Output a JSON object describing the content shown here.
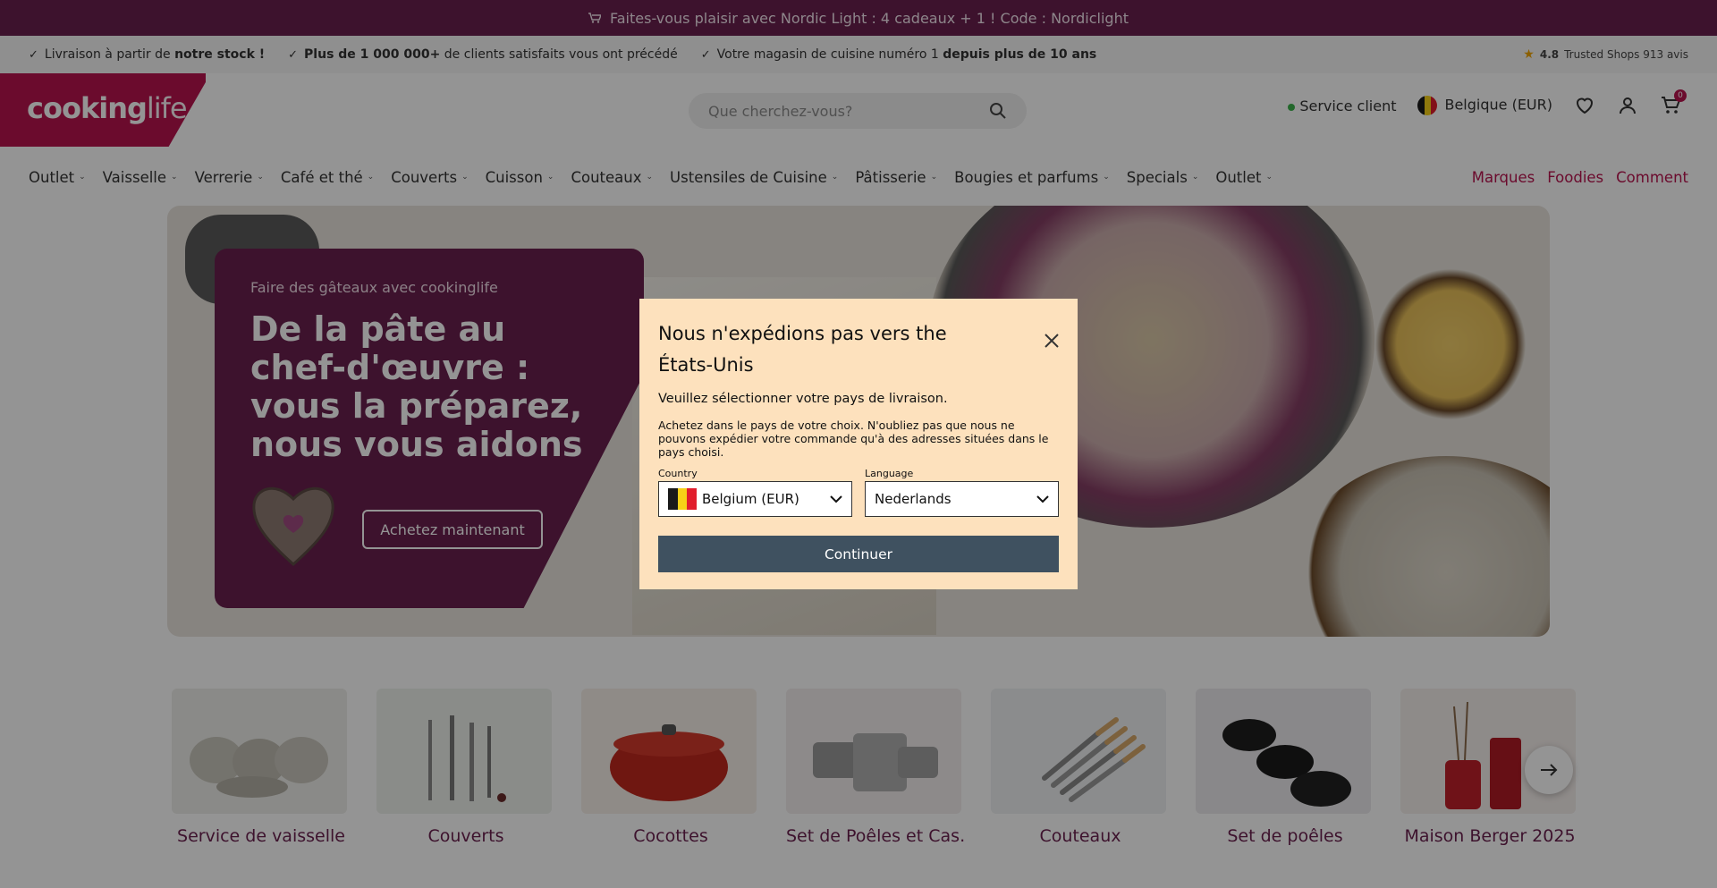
{
  "announcement": {
    "text": "Faites-vous plaisir avec Nordic Light : 4 cadeaux + 1 ! Code : Nordiclight"
  },
  "usp": [
    {
      "pre": "Livraison à partir de ",
      "bold": "notre stock !",
      "post": ""
    },
    {
      "pre": "",
      "bold": "Plus de 1 000 000+",
      "post": " de clients satisfaits vous ont précédé"
    },
    {
      "pre": "Votre magasin de cuisine numéro 1 ",
      "bold": "depuis plus de 10 ans",
      "post": ""
    }
  ],
  "rating": {
    "score": "4.8",
    "text": "Trusted Shops 913 avis"
  },
  "logo": {
    "part1": "cooking",
    "part2": "life"
  },
  "search": {
    "placeholder": "Que cherchez-vous?"
  },
  "header": {
    "service": "Service client",
    "country": "Belgique (EUR)",
    "cart_count": "0"
  },
  "nav": {
    "items": [
      "Outlet",
      "Vaisselle",
      "Verrerie",
      "Café et thé",
      "Couverts",
      "Cuisson",
      "Couteaux",
      "Ustensiles de Cuisine",
      "Pâtisserie",
      "Bougies et parfums",
      "Specials",
      "Outlet"
    ],
    "right": [
      "Marques",
      "Foodies",
      "Comment"
    ]
  },
  "hero": {
    "eyebrow": "Faire des gâteaux avec cookinglife",
    "title": "De la pâte au chef-d'œuvre : vous la préparez, nous vous aidons",
    "cta": "Achetez maintenant"
  },
  "categories": [
    {
      "label": "Service de vaisselle",
      "bg": "#eeeeea"
    },
    {
      "label": "Couverts",
      "bg": "#eef2ec"
    },
    {
      "label": "Cocottes",
      "bg": "#f7efe9"
    },
    {
      "label": "Set de Poêles et Cas…",
      "bg": "#f3eeee"
    },
    {
      "label": "Couteaux",
      "bg": "#f0f1f3"
    },
    {
      "label": "Set de poêles",
      "bg": "#ecebee"
    },
    {
      "label": "Maison Berger 2025",
      "bg": "#f5efec"
    }
  ],
  "modal": {
    "title": "Nous n'expédions pas vers the États-Unis",
    "subtitle": "Veuillez sélectionner votre pays de livraison.",
    "body": "Achetez dans le pays de votre choix. N'oubliez pas que nous ne pouvons expédier votre commande qu'à des adresses situées dans le pays choisi.",
    "country_label": "Country",
    "country_value": "Belgium (EUR)",
    "language_label": "Language",
    "language_value": "Nederlands",
    "continue": "Continuer"
  },
  "colors": {
    "brand": "#b8134f",
    "plum": "#6a1f4e",
    "modal_bg": "#fde1bd",
    "button": "#3f5160"
  },
  "icons": [
    "cart-icon",
    "check-icon",
    "star-icon",
    "search-icon",
    "heart-icon",
    "user-icon",
    "chevron-down-icon",
    "close-icon",
    "arrow-right-icon"
  ]
}
